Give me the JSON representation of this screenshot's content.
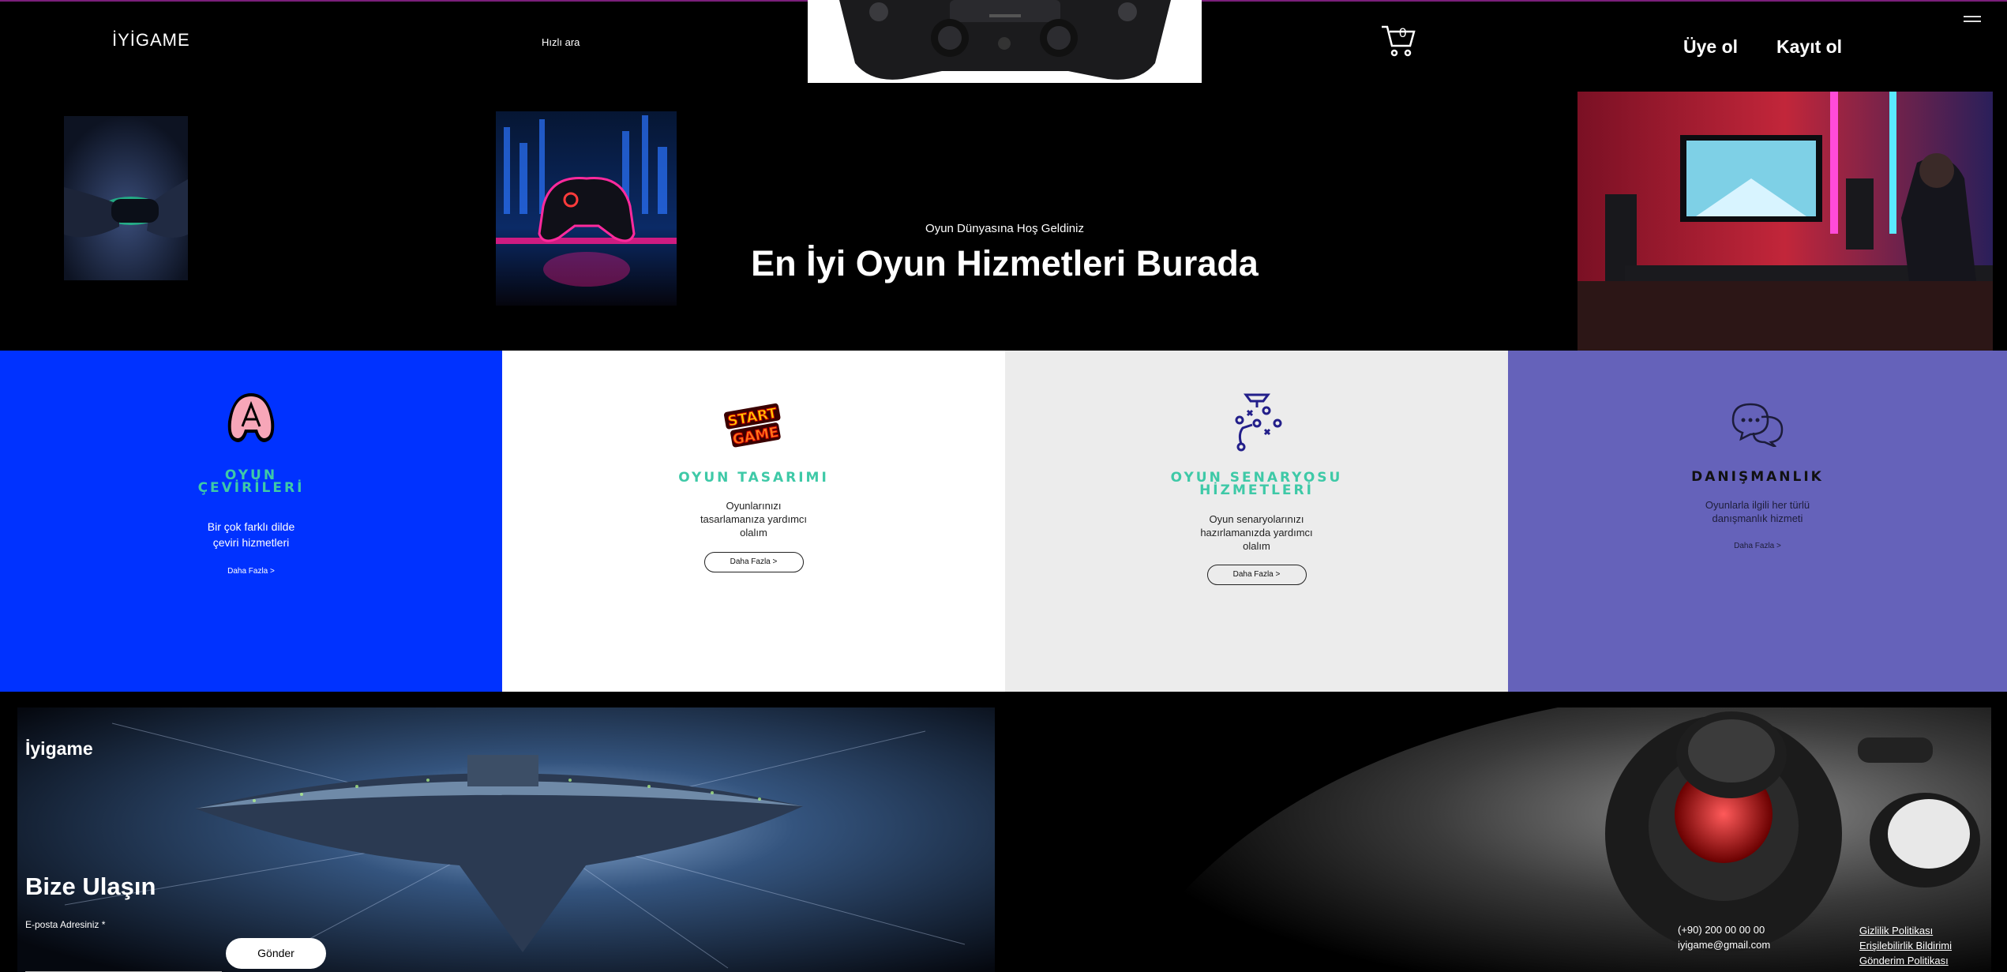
{
  "header": {
    "logo": "İYİGAME",
    "quick_search": "Hızlı ara",
    "cart_count": "0",
    "member_label": "Üye ol",
    "signup_label": "Kayıt ol"
  },
  "hero": {
    "subtitle": "Oyun Dünyasına Hoş Geldiniz",
    "title": "En İyi Oyun Hizmetleri Burada"
  },
  "services": [
    {
      "title": "OYUN ÇEVİRİLERİ",
      "text": "Bir çok farklı dilde çeviri hizmetleri",
      "link": "Daha Fazla >",
      "icon": "letter-a-icon"
    },
    {
      "title": "OYUN TASARIMI",
      "text": "Oyunlarınızı tasarlamanıza yardımcı olalım",
      "link": "Daha Fazla >",
      "icon": "start-game-icon"
    },
    {
      "title": "OYUN SENARYOSU HİZMETLERİ",
      "text": "Oyun senaryolarınızı hazırlamanızda yardımcı olalım",
      "link": "Daha Fazla >",
      "icon": "strategy-icon"
    },
    {
      "title": "DANIŞMANLIK",
      "text": "Oyunlarla ilgili her türlü danışmanlık hizmeti",
      "link": "Daha Fazla >",
      "icon": "chat-icon"
    }
  ],
  "footer": {
    "logo": "İyigame",
    "contact_title": "Bize Ulaşın",
    "email_label": "E-posta Adresiniz *",
    "send_label": "Gönder",
    "phone": "(+90) 200 00 00 00",
    "email": "iyigame@gmail.com",
    "policies": [
      "Gizlilik Politikası",
      "Erişilebilirlik Bildirimi",
      "Gönderim Politikası"
    ]
  },
  "colors": {
    "accent_teal": "#3ec9a7",
    "blue": "#0032ff",
    "purple": "#6562ba",
    "navy_icon": "#231f8a"
  }
}
